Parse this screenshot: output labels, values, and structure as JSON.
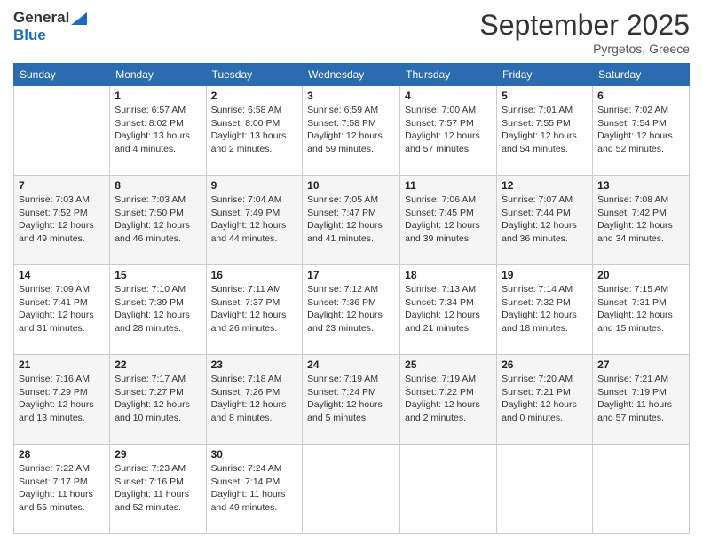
{
  "header": {
    "logo_line1": "General",
    "logo_line2": "Blue",
    "month": "September 2025",
    "location": "Pyrgetos, Greece"
  },
  "weekdays": [
    "Sunday",
    "Monday",
    "Tuesday",
    "Wednesday",
    "Thursday",
    "Friday",
    "Saturday"
  ],
  "weeks": [
    [
      {
        "day": "",
        "sunrise": "",
        "sunset": "",
        "daylight": ""
      },
      {
        "day": "1",
        "sunrise": "Sunrise: 6:57 AM",
        "sunset": "Sunset: 8:02 PM",
        "daylight": "Daylight: 13 hours and 4 minutes."
      },
      {
        "day": "2",
        "sunrise": "Sunrise: 6:58 AM",
        "sunset": "Sunset: 8:00 PM",
        "daylight": "Daylight: 13 hours and 2 minutes."
      },
      {
        "day": "3",
        "sunrise": "Sunrise: 6:59 AM",
        "sunset": "Sunset: 7:58 PM",
        "daylight": "Daylight: 12 hours and 59 minutes."
      },
      {
        "day": "4",
        "sunrise": "Sunrise: 7:00 AM",
        "sunset": "Sunset: 7:57 PM",
        "daylight": "Daylight: 12 hours and 57 minutes."
      },
      {
        "day": "5",
        "sunrise": "Sunrise: 7:01 AM",
        "sunset": "Sunset: 7:55 PM",
        "daylight": "Daylight: 12 hours and 54 minutes."
      },
      {
        "day": "6",
        "sunrise": "Sunrise: 7:02 AM",
        "sunset": "Sunset: 7:54 PM",
        "daylight": "Daylight: 12 hours and 52 minutes."
      }
    ],
    [
      {
        "day": "7",
        "sunrise": "Sunrise: 7:03 AM",
        "sunset": "Sunset: 7:52 PM",
        "daylight": "Daylight: 12 hours and 49 minutes."
      },
      {
        "day": "8",
        "sunrise": "Sunrise: 7:03 AM",
        "sunset": "Sunset: 7:50 PM",
        "daylight": "Daylight: 12 hours and 46 minutes."
      },
      {
        "day": "9",
        "sunrise": "Sunrise: 7:04 AM",
        "sunset": "Sunset: 7:49 PM",
        "daylight": "Daylight: 12 hours and 44 minutes."
      },
      {
        "day": "10",
        "sunrise": "Sunrise: 7:05 AM",
        "sunset": "Sunset: 7:47 PM",
        "daylight": "Daylight: 12 hours and 41 minutes."
      },
      {
        "day": "11",
        "sunrise": "Sunrise: 7:06 AM",
        "sunset": "Sunset: 7:45 PM",
        "daylight": "Daylight: 12 hours and 39 minutes."
      },
      {
        "day": "12",
        "sunrise": "Sunrise: 7:07 AM",
        "sunset": "Sunset: 7:44 PM",
        "daylight": "Daylight: 12 hours and 36 minutes."
      },
      {
        "day": "13",
        "sunrise": "Sunrise: 7:08 AM",
        "sunset": "Sunset: 7:42 PM",
        "daylight": "Daylight: 12 hours and 34 minutes."
      }
    ],
    [
      {
        "day": "14",
        "sunrise": "Sunrise: 7:09 AM",
        "sunset": "Sunset: 7:41 PM",
        "daylight": "Daylight: 12 hours and 31 minutes."
      },
      {
        "day": "15",
        "sunrise": "Sunrise: 7:10 AM",
        "sunset": "Sunset: 7:39 PM",
        "daylight": "Daylight: 12 hours and 28 minutes."
      },
      {
        "day": "16",
        "sunrise": "Sunrise: 7:11 AM",
        "sunset": "Sunset: 7:37 PM",
        "daylight": "Daylight: 12 hours and 26 minutes."
      },
      {
        "day": "17",
        "sunrise": "Sunrise: 7:12 AM",
        "sunset": "Sunset: 7:36 PM",
        "daylight": "Daylight: 12 hours and 23 minutes."
      },
      {
        "day": "18",
        "sunrise": "Sunrise: 7:13 AM",
        "sunset": "Sunset: 7:34 PM",
        "daylight": "Daylight: 12 hours and 21 minutes."
      },
      {
        "day": "19",
        "sunrise": "Sunrise: 7:14 AM",
        "sunset": "Sunset: 7:32 PM",
        "daylight": "Daylight: 12 hours and 18 minutes."
      },
      {
        "day": "20",
        "sunrise": "Sunrise: 7:15 AM",
        "sunset": "Sunset: 7:31 PM",
        "daylight": "Daylight: 12 hours and 15 minutes."
      }
    ],
    [
      {
        "day": "21",
        "sunrise": "Sunrise: 7:16 AM",
        "sunset": "Sunset: 7:29 PM",
        "daylight": "Daylight: 12 hours and 13 minutes."
      },
      {
        "day": "22",
        "sunrise": "Sunrise: 7:17 AM",
        "sunset": "Sunset: 7:27 PM",
        "daylight": "Daylight: 12 hours and 10 minutes."
      },
      {
        "day": "23",
        "sunrise": "Sunrise: 7:18 AM",
        "sunset": "Sunset: 7:26 PM",
        "daylight": "Daylight: 12 hours and 8 minutes."
      },
      {
        "day": "24",
        "sunrise": "Sunrise: 7:19 AM",
        "sunset": "Sunset: 7:24 PM",
        "daylight": "Daylight: 12 hours and 5 minutes."
      },
      {
        "day": "25",
        "sunrise": "Sunrise: 7:19 AM",
        "sunset": "Sunset: 7:22 PM",
        "daylight": "Daylight: 12 hours and 2 minutes."
      },
      {
        "day": "26",
        "sunrise": "Sunrise: 7:20 AM",
        "sunset": "Sunset: 7:21 PM",
        "daylight": "Daylight: 12 hours and 0 minutes."
      },
      {
        "day": "27",
        "sunrise": "Sunrise: 7:21 AM",
        "sunset": "Sunset: 7:19 PM",
        "daylight": "Daylight: 11 hours and 57 minutes."
      }
    ],
    [
      {
        "day": "28",
        "sunrise": "Sunrise: 7:22 AM",
        "sunset": "Sunset: 7:17 PM",
        "daylight": "Daylight: 11 hours and 55 minutes."
      },
      {
        "day": "29",
        "sunrise": "Sunrise: 7:23 AM",
        "sunset": "Sunset: 7:16 PM",
        "daylight": "Daylight: 11 hours and 52 minutes."
      },
      {
        "day": "30",
        "sunrise": "Sunrise: 7:24 AM",
        "sunset": "Sunset: 7:14 PM",
        "daylight": "Daylight: 11 hours and 49 minutes."
      },
      {
        "day": "",
        "sunrise": "",
        "sunset": "",
        "daylight": ""
      },
      {
        "day": "",
        "sunrise": "",
        "sunset": "",
        "daylight": ""
      },
      {
        "day": "",
        "sunrise": "",
        "sunset": "",
        "daylight": ""
      },
      {
        "day": "",
        "sunrise": "",
        "sunset": "",
        "daylight": ""
      }
    ]
  ]
}
